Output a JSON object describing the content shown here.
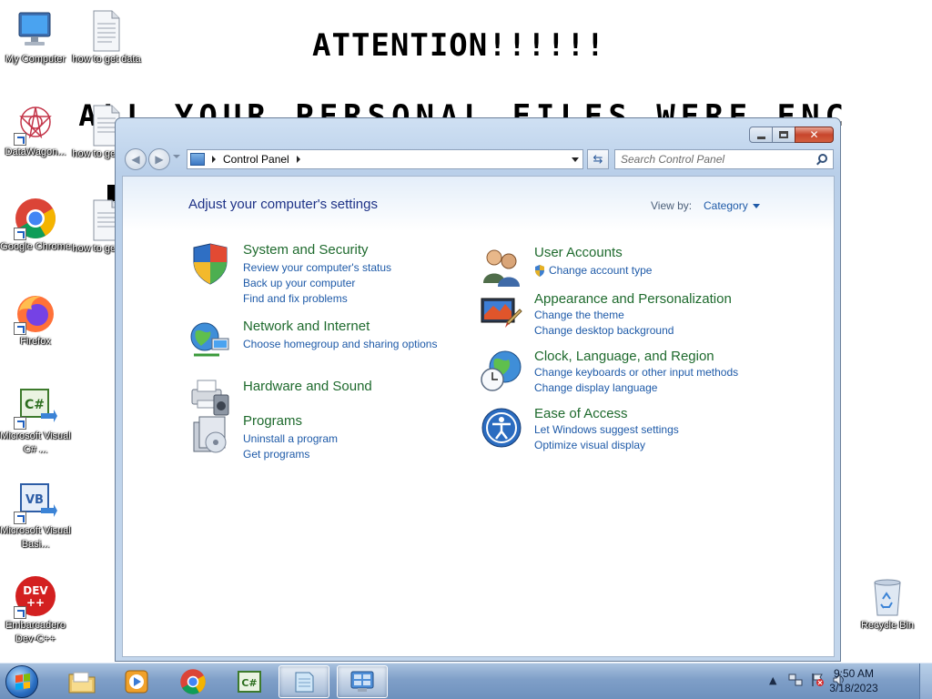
{
  "wallpaper": {
    "title": "ATTENTION!!!!!!",
    "line": "ALL YOUR PERSONAL FILES WERE ENCRYPTED"
  },
  "desktop_icons": [
    {
      "label": "My Computer",
      "icon": "computer-icon"
    },
    {
      "label": "how to get data",
      "icon": "text-file-icon"
    },
    {
      "label": "DataWagon...",
      "icon": "datawagon-icon"
    },
    {
      "label": "how to get data",
      "icon": "text-file-icon"
    },
    {
      "label": "Google Chrome",
      "icon": "chrome-icon"
    },
    {
      "label": "how to get data",
      "icon": "text-file-icon"
    },
    {
      "label": "Firefox",
      "icon": "firefox-icon"
    },
    {
      "label": "Microsoft Visual C# ...",
      "icon": "visual-csharp-icon"
    },
    {
      "label": "Microsoft Visual Basi...",
      "icon": "visual-basic-icon"
    },
    {
      "label": "Embarcadero Dev-C++",
      "icon": "devcpp-icon"
    },
    {
      "label": "Recycle Bin",
      "icon": "recycle-bin-icon"
    }
  ],
  "window": {
    "address": "Control Panel",
    "search_placeholder": "Search Control Panel",
    "heading": "Adjust your computer's settings",
    "view_by_label": "View by:",
    "view_by_value": "Category",
    "categories": [
      {
        "title": "System and Security",
        "icon": "shield-icon",
        "links": [
          "Review your computer's status",
          "Back up your computer",
          "Find and fix problems"
        ]
      },
      {
        "title": "Network and Internet",
        "icon": "network-globe-icon",
        "links": [
          "Choose homegroup and sharing options"
        ]
      },
      {
        "title": "Hardware and Sound",
        "icon": "printer-speaker-icon",
        "links": []
      },
      {
        "title": "Programs",
        "icon": "programs-icon",
        "links": [
          "Uninstall a program",
          "Get programs"
        ]
      },
      {
        "title": "User Accounts",
        "icon": "users-icon",
        "links": [
          "Change account type"
        ]
      },
      {
        "title": "Appearance and Personalization",
        "icon": "monitor-paint-icon",
        "links": [
          "Change the theme",
          "Change desktop background"
        ]
      },
      {
        "title": "Clock, Language, and Region",
        "icon": "clock-globe-icon",
        "links": [
          "Change keyboards or other input methods",
          "Change display language"
        ]
      },
      {
        "title": "Ease of Access",
        "icon": "ease-of-access-icon",
        "links": [
          "Let Windows suggest settings",
          "Optimize visual display"
        ]
      }
    ]
  },
  "taskbar": {
    "pinned": [
      {
        "name": "windows-explorer",
        "icon": "folder-icon"
      },
      {
        "name": "media-player",
        "icon": "media-player-icon"
      },
      {
        "name": "chrome",
        "icon": "chrome-icon"
      },
      {
        "name": "visual-csharp",
        "icon": "visual-csharp-icon"
      },
      {
        "name": "notepad",
        "icon": "notepad-icon"
      },
      {
        "name": "control-panel",
        "icon": "control-panel-icon"
      }
    ],
    "time": "9:50 AM",
    "date": "3/18/2023"
  }
}
